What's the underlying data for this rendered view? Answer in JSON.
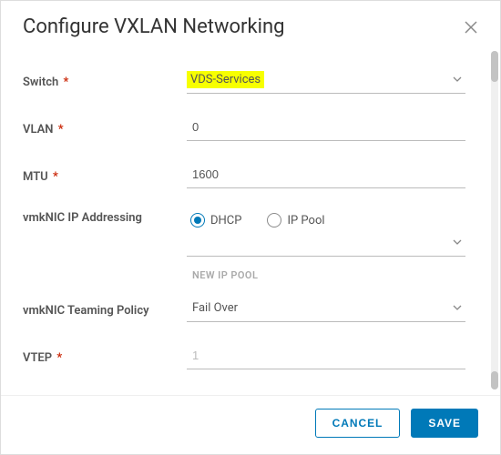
{
  "dialog": {
    "title": "Configure VXLAN Networking"
  },
  "form": {
    "switch": {
      "label": "Switch",
      "required_marker": "*",
      "value": "VDS-Services"
    },
    "vlan": {
      "label": "VLAN",
      "required_marker": "*",
      "value": "0"
    },
    "mtu": {
      "label": "MTU",
      "required_marker": "*",
      "value": "1600"
    },
    "ip_addressing": {
      "label": "vmkNIC IP Addressing",
      "options": {
        "dhcp": "DHCP",
        "ip_pool": "IP Pool"
      },
      "selected": "dhcp",
      "new_ip_pool_label": "NEW IP POOL"
    },
    "teaming_policy": {
      "label": "vmkNIC Teaming Policy",
      "value": "Fail Over"
    },
    "vtep": {
      "label": "VTEP",
      "required_marker": "*",
      "value": "1"
    }
  },
  "footer": {
    "cancel": "Cancel",
    "save": "Save"
  }
}
